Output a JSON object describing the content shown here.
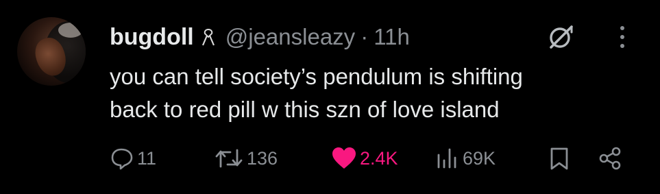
{
  "tweet": {
    "author": {
      "display_name": "bugdoll",
      "name_emoji": "ribbon-emoji",
      "handle": "@jeansleazy",
      "separator": "·",
      "time": "11h"
    },
    "text_lines": [
      "you can tell society’s pendulum is shifting",
      "back to red pill w this szn of love island"
    ],
    "actions": {
      "reply": {
        "icon": "reply-icon",
        "count": "11"
      },
      "repost": {
        "icon": "repost-icon",
        "count": "136"
      },
      "like": {
        "icon": "heart-icon",
        "count": "2.4K",
        "active": true,
        "color": "#f91880"
      },
      "views": {
        "icon": "views-icon",
        "count": "69K"
      },
      "bookmark": {
        "icon": "bookmark-icon"
      },
      "share": {
        "icon": "share-icon"
      }
    },
    "header_icons": [
      "grok-icon",
      "more-icon"
    ]
  },
  "colors": {
    "background": "#000000",
    "primary_text": "#e7e9ea",
    "secondary_text": "#8b8f94",
    "like": "#f91880"
  }
}
